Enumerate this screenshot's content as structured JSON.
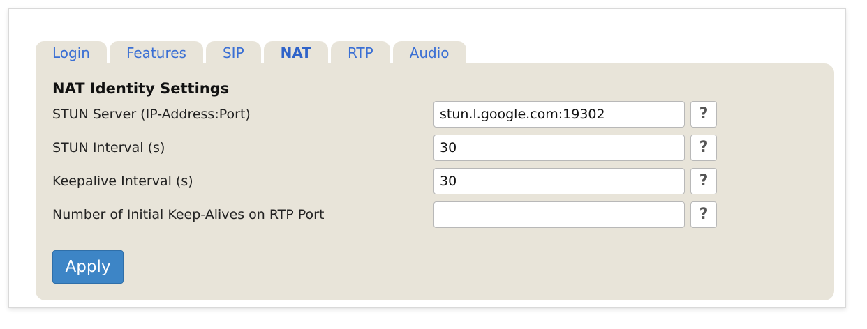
{
  "tabs": [
    {
      "label": "Login",
      "active": false
    },
    {
      "label": "Features",
      "active": false
    },
    {
      "label": "SIP",
      "active": false
    },
    {
      "label": "NAT",
      "active": true
    },
    {
      "label": "RTP",
      "active": false
    },
    {
      "label": "Audio",
      "active": false
    }
  ],
  "section": {
    "title": "NAT Identity Settings"
  },
  "fields": [
    {
      "label": "STUN Server (IP-Address:Port)",
      "value": "stun.l.google.com:19302",
      "help": "?"
    },
    {
      "label": "STUN Interval (s)",
      "value": "30",
      "help": "?"
    },
    {
      "label": "Keepalive Interval (s)",
      "value": "30",
      "help": "?"
    },
    {
      "label": "Number of Initial Keep-Alives on RTP Port",
      "value": "",
      "help": "?"
    }
  ],
  "actions": {
    "apply_label": "Apply"
  },
  "colors": {
    "panel_bg": "#e8e4d9",
    "tab_text": "#3a6fd4",
    "apply_bg": "#3d85c6"
  }
}
